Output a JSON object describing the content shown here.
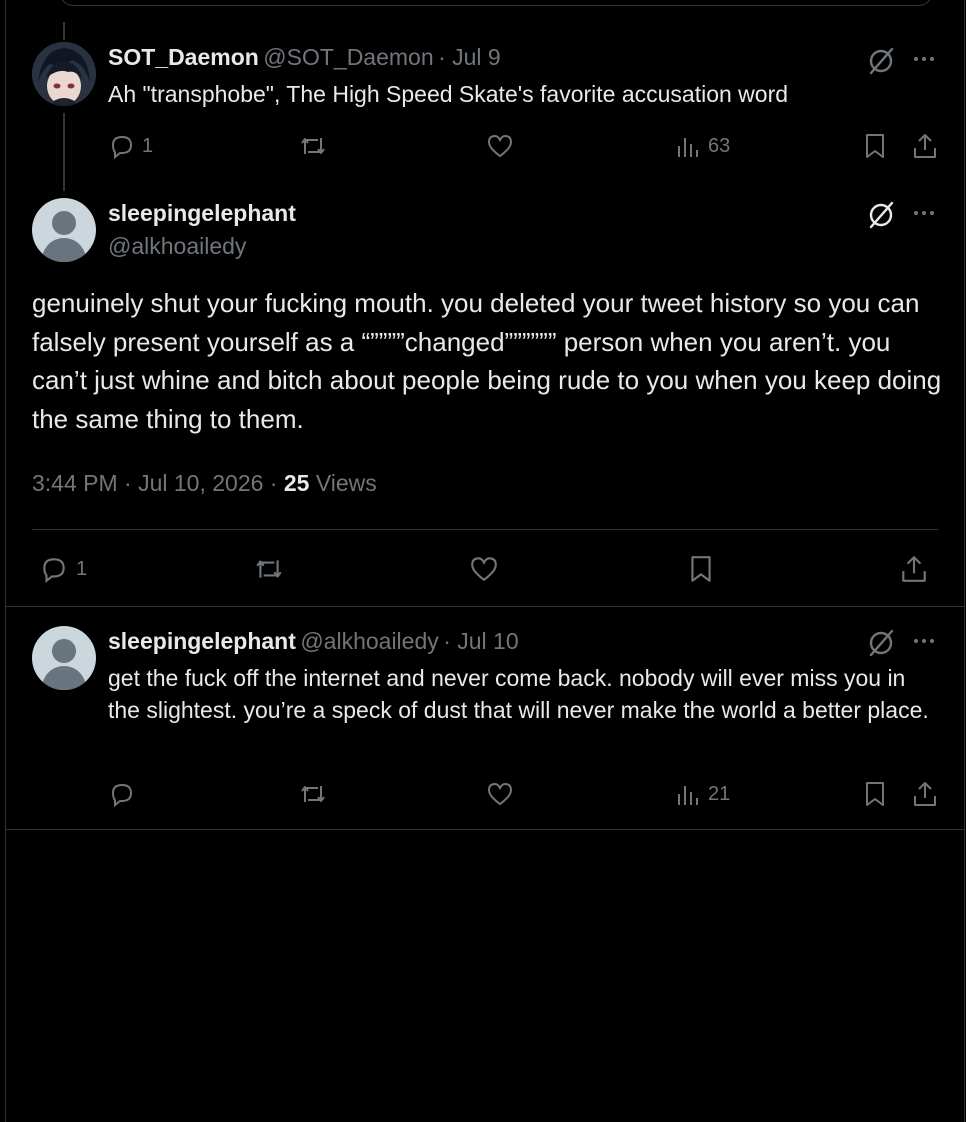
{
  "tweet1": {
    "display_name": "SOT_Daemon",
    "handle": "@SOT_Daemon",
    "date": "· Jul 9",
    "text": "Ah \"transphobe\", The High Speed Skate's favorite accusation word",
    "reply_count": "1",
    "views": "63"
  },
  "main_tweet": {
    "display_name": "sleepingelephant",
    "handle": "@alkhoailedy",
    "text": "genuinely shut your fucking mouth. you deleted your tweet history so you can falsely present yourself as a “””””changed”””””” person when you aren’t. you can’t just whine and bitch about people being rude to you when you keep doing the same thing to them.",
    "timestamp": "3:44 PM · Jul 10, 2026 · ",
    "views_count": "25",
    "views_label": " Views",
    "reply_count": "1"
  },
  "reply_tweet": {
    "display_name": "sleepingelephant",
    "handle": "@alkhoailedy",
    "date": "· Jul 10",
    "text": "get the fuck off the internet and never come back. nobody will ever miss you in the slightest. you’re a speck of dust that will never make the world a better place.",
    "views": "21"
  },
  "colors": {
    "background": "#000000",
    "text": "#e7e9ea",
    "muted": "#71767b",
    "border": "#2f3336"
  },
  "icons": [
    "reply-icon",
    "retweet-icon",
    "like-icon",
    "views-icon",
    "bookmark-icon",
    "share-icon",
    "grok-icon",
    "more-icon"
  ]
}
